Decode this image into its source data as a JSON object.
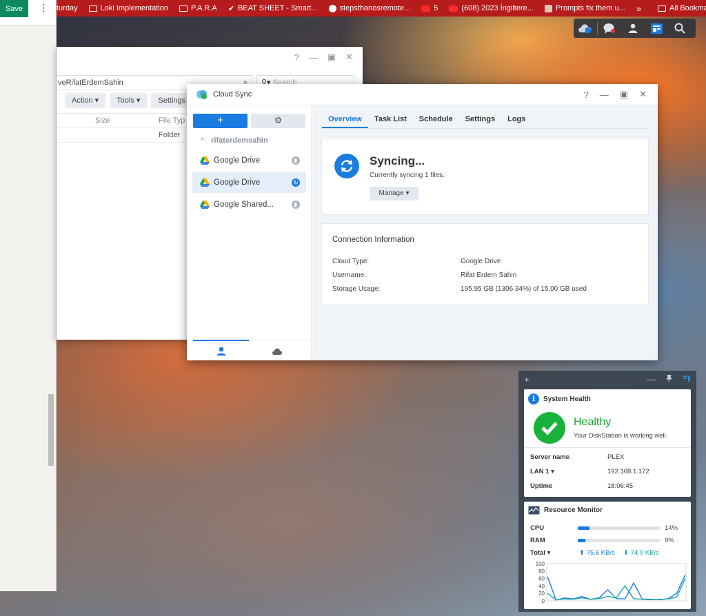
{
  "browser": {
    "bookmarks": [
      {
        "label": "turday",
        "icon": "none"
      },
      {
        "label": "Loki Implementation",
        "icon": "folder-icon"
      },
      {
        "label": "P.A.R.A",
        "icon": "folder-icon"
      },
      {
        "label": "BEAT SHEET - Smart...",
        "icon": "checkmark-icon"
      },
      {
        "label": "stepsthanosremote...",
        "icon": "github-icon"
      },
      {
        "label": "5",
        "icon": "youtube-icon"
      },
      {
        "label": "(608) 2023 İngiltere...",
        "icon": "youtube-icon"
      },
      {
        "label": "Prompts fix them u...",
        "icon": "avatar-icon"
      }
    ],
    "overflow": "»",
    "all_bookmarks": "All Bookmarks"
  },
  "left_pane": {
    "save_label": "Save",
    "menu_glyph": "⋮"
  },
  "file_station": {
    "path": "veRifatErdemSahin",
    "search_placeholder": "Search",
    "toolbar": [
      "Action ▾",
      "Tools ▾",
      "Settings"
    ],
    "columns": [
      "Size",
      "File Typ"
    ],
    "row_type": "Folder"
  },
  "cloud_sync": {
    "title": "Cloud Sync",
    "window_buttons": [
      "?",
      "—",
      "▣",
      "✕"
    ],
    "add_label": "+",
    "account": "rifaterdemsahin",
    "connections": [
      {
        "label": "Google Drive",
        "status": "paused"
      },
      {
        "label": "Google Drive",
        "status": "syncing"
      },
      {
        "label": "Google Shared...",
        "status": "paused"
      }
    ],
    "tabs": [
      "Overview",
      "Task List",
      "Schedule",
      "Settings",
      "Logs"
    ],
    "active_tab": "Overview",
    "status": {
      "title": "Syncing...",
      "subtitle": "Currently syncing 1 files.",
      "manage_label": "Manage ▾"
    },
    "connection_info": {
      "title": "Connection Information",
      "rows": [
        {
          "label": "Cloud Type:",
          "value": "Google Drive"
        },
        {
          "label": "Username:",
          "value": "Rifat Erdem Sahin"
        },
        {
          "label": "Storage Usage:",
          "value": "195.95 GB (1306.34%) of 15.00 GB used"
        }
      ]
    }
  },
  "widgets": {
    "top_icons": [
      "+",
      "—",
      "pin-icon",
      "collapse-icon"
    ],
    "system_health": {
      "title": "System Health",
      "status": "Healthy",
      "message": "Your DiskStation is working well.",
      "rows": [
        {
          "label": "Server name",
          "value": "PLEX"
        },
        {
          "label": "LAN 1 ▾",
          "value": "192.168.1.172"
        },
        {
          "label": "Uptime",
          "value": "18:06:45"
        }
      ]
    },
    "resource_monitor": {
      "title": "Resource Monitor",
      "cpu_label": "CPU",
      "cpu_value": 14,
      "cpu_text": "14%",
      "ram_label": "RAM",
      "ram_value": 9,
      "ram_text": "9%",
      "total_label": "Total ▾",
      "upload": "75.6 KB/s",
      "download": "74.9 KB/s",
      "upload_color": "#1a7be0",
      "download_color": "#1aa6a6"
    }
  },
  "chart_data": {
    "type": "line",
    "title": "",
    "xlabel": "",
    "ylabel": "",
    "ylim": [
      0,
      100
    ],
    "yticks": [
      "100",
      "80",
      "60",
      "40",
      "20",
      "0"
    ],
    "series": [
      {
        "values": [
          65,
          2,
          8,
          5,
          12,
          4,
          8,
          30,
          6,
          5,
          48,
          5,
          4,
          3,
          6,
          20,
          70
        ]
      },
      {
        "values": [
          20,
          3,
          5,
          4,
          8,
          4,
          6,
          12,
          8,
          40,
          6,
          4,
          3,
          4,
          5,
          10,
          60
        ]
      }
    ]
  }
}
